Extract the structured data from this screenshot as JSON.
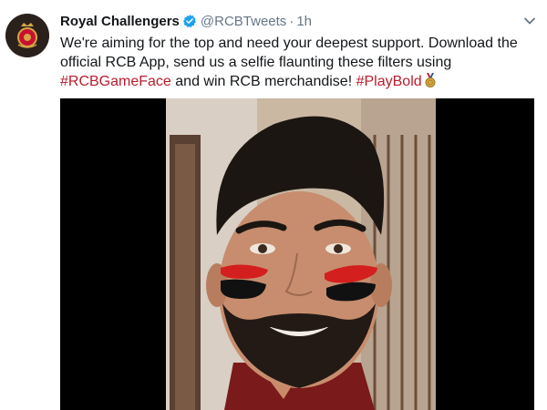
{
  "tweet": {
    "display_name": "Royal Challengers",
    "handle": "@RCBTweets",
    "separator": "·",
    "time": "1h",
    "text_part1": "We're aiming for the top and need your deepest support. Download the official RCB App, send us a selfie flaunting these filters using ",
    "hashtag1": "#RCBGameFace",
    "text_part2": " and win RCB merchandise! ",
    "hashtag2": "#PlayBold"
  },
  "icons": {
    "avatar": "rcb-logo-avatar",
    "verified": "verified-badge-icon",
    "menu": "chevron-down-icon",
    "emoji": "medal-emoji-icon"
  },
  "colors": {
    "hashtag": "#b91c2c",
    "verified": "#1da1f2",
    "muted": "#657786",
    "face_paint_red": "#d41f1f",
    "face_paint_black": "#111111"
  }
}
